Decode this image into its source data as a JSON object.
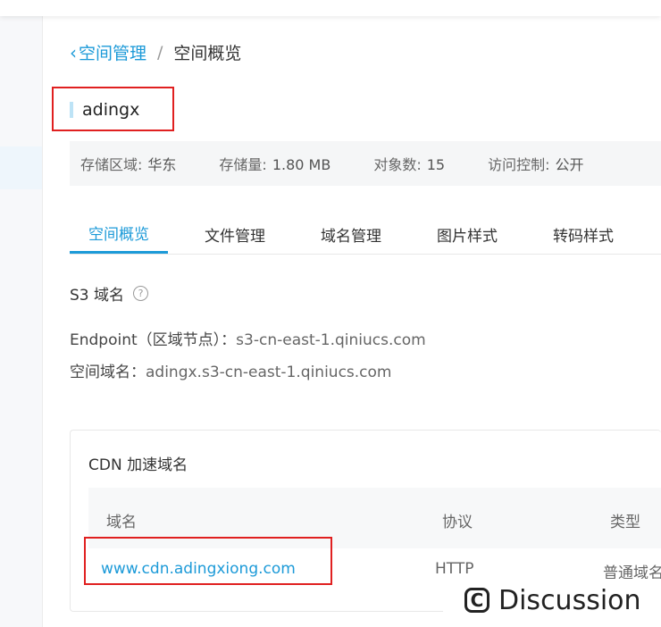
{
  "breadcrumb": {
    "back_label": "空间管理",
    "separator": "/",
    "current": "空间概览"
  },
  "bucket": {
    "name": "adingx"
  },
  "info": {
    "region_label": "存储区域:",
    "region_value": "华东",
    "storage_label": "存储量:",
    "storage_value": "1.80 MB",
    "objects_label": "对象数:",
    "objects_value": "15",
    "access_label": "访问控制:",
    "access_value": "公开"
  },
  "tabs": [
    {
      "label": "空间概览",
      "active": true
    },
    {
      "label": "文件管理",
      "active": false
    },
    {
      "label": "域名管理",
      "active": false
    },
    {
      "label": "图片样式",
      "active": false
    },
    {
      "label": "转码样式",
      "active": false
    }
  ],
  "s3": {
    "title": "S3 域名",
    "endpoint_label": "Endpoint（区域节点）：",
    "endpoint_value": "s3-cn-east-1.qiniucs.com",
    "domain_label": "空间域名：",
    "domain_value": "adingx.s3-cn-east-1.qiniucs.com"
  },
  "cdn": {
    "title": "CDN 加速域名",
    "columns": [
      "域名",
      "协议",
      "类型"
    ],
    "rows": [
      {
        "domain": "www.cdn.adingxiong.com",
        "protocol": "HTTP",
        "type": "普通域名"
      }
    ]
  },
  "watermark": {
    "icon_letter": "C",
    "text": "Discussion"
  },
  "colors": {
    "accent": "#1c9ad8",
    "highlight_box": "#e02020"
  }
}
